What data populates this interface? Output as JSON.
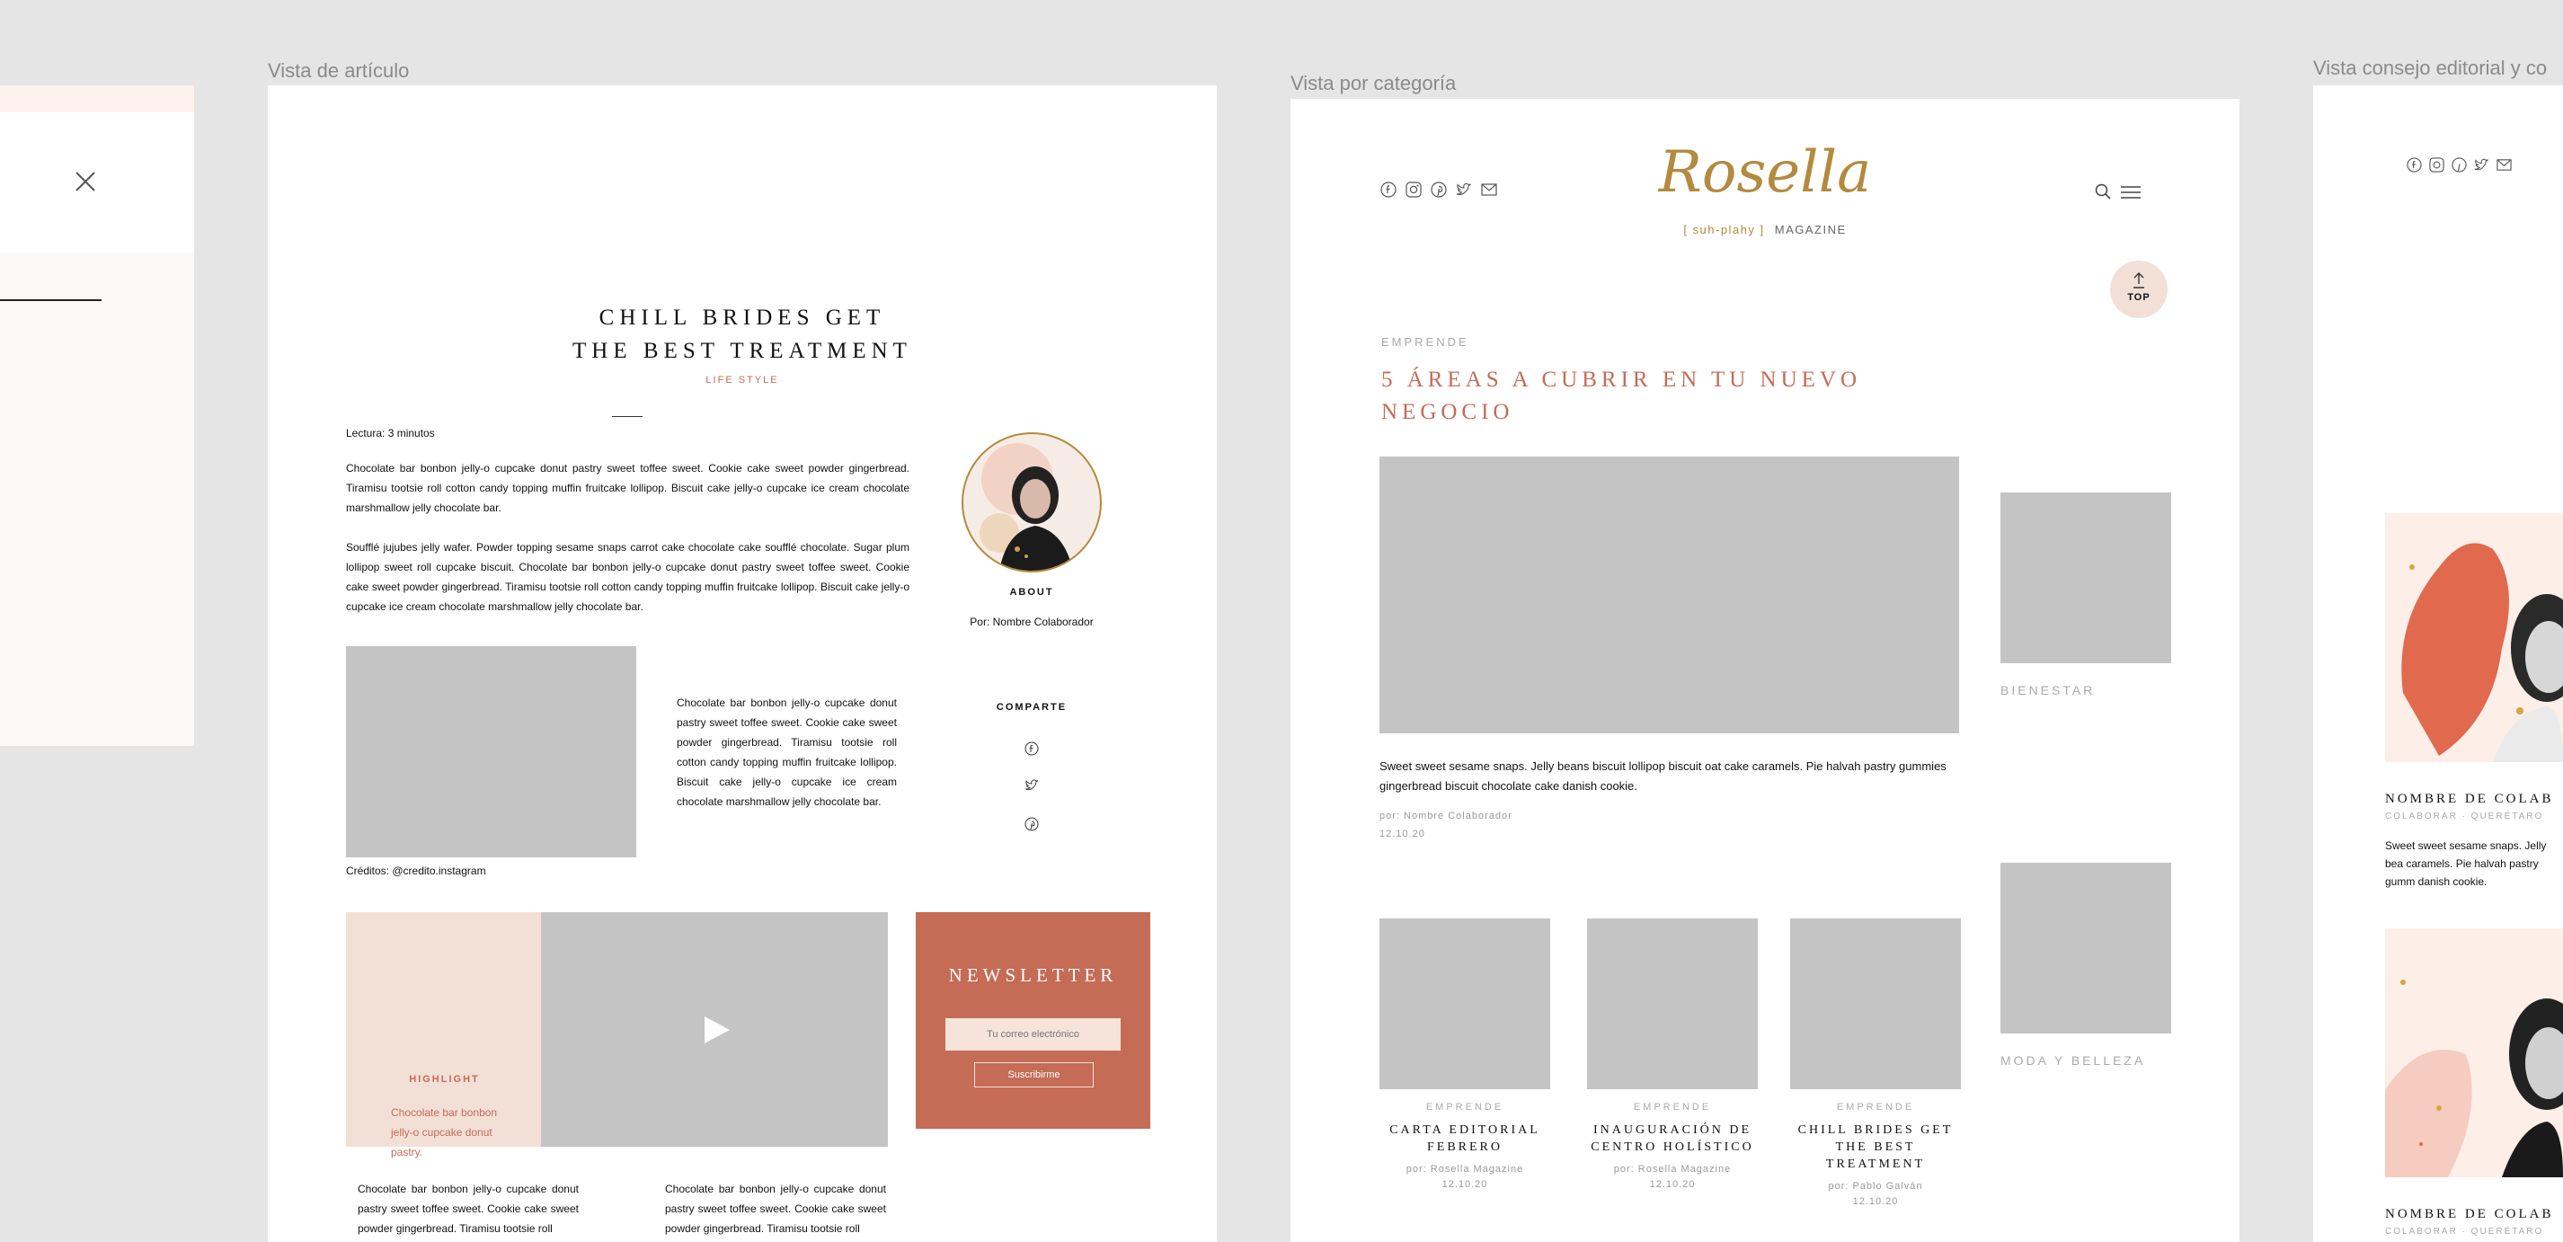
{
  "labels": {
    "article_view": "Vista de artículo",
    "category_view": "Vista por categoría",
    "editorial_view": "Vista consejo editorial y co"
  },
  "article": {
    "title_line1": "CHILL BRIDES GET",
    "title_line2": "THE BEST TREATMENT",
    "category": "LIFE STYLE",
    "reading_time": "Lectura: 3 minutos",
    "para1": "Chocolate bar bonbon jelly-o cupcake donut pastry sweet toffee sweet. Cookie cake sweet powder gingerbread. Tiramisu tootsie roll cotton candy topping muffin fruitcake lollipop. Biscuit cake jelly-o cupcake ice cream chocolate marshmallow jelly chocolate bar.",
    "para2": "Soufflé jujubes jelly wafer. Powder topping sesame snaps carrot cake chocolate cake soufflé chocolate. Sugar plum lollipop sweet roll cupcake biscuit. Chocolate bar bonbon jelly-o cupcake donut pastry sweet toffee sweet. Cookie cake sweet powder gingerbread. Tiramisu tootsie roll cotton candy topping muffin fruitcake lollipop. Biscuit cake jelly-o cupcake ice cream chocolate marshmallow jelly chocolate bar.",
    "side_text": "Chocolate bar bonbon jelly-o cupcake donut pastry sweet toffee sweet. Cookie cake sweet powder gingerbread. Tiramisu tootsie roll cotton candy topping muffin fruitcake lollipop. Biscuit cake jelly-o cupcake ice cream chocolate marshmallow jelly chocolate bar.",
    "credits": "Créditos: @credito.instagram",
    "about_label": "ABOUT",
    "author": "Por: Nombre Colaborador",
    "share_label": "COMPARTE",
    "highlight_label": "HIGHLIGHT",
    "highlight_text": "Chocolate bar bonbon jelly-o cupcake donut pastry.",
    "newsletter_title": "NEWSLETTER",
    "newsletter_placeholder": "Tu correo electrónico",
    "newsletter_button": "Suscribirme",
    "bottom_col1": "Chocolate bar bonbon jelly-o cupcake donut pastry sweet toffee sweet. Cookie cake sweet powder gingerbread. Tiramisu tootsie roll",
    "bottom_col2": "Chocolate bar bonbon jelly-o cupcake donut pastry sweet toffee sweet. Cookie cake sweet powder gingerbread. Tiramisu tootsie roll"
  },
  "category": {
    "logo": "Rosella",
    "tagline_bracket": "[ suh-plahy ]",
    "tagline_magazine": "MAGAZINE",
    "top_label": "TOP",
    "section": "EMPRENDE",
    "headline_line1": "5 ÁREAS A CUBRIR EN TU NUEVO",
    "headline_line2": "NEGOCIO",
    "excerpt": "Sweet sweet sesame snaps. Jelly beans biscuit lollipop biscuit oat cake caramels. Pie halvah pastry gummies gingerbread biscuit chocolate cake danish cookie.",
    "byline": "por: Nombre Colaborador",
    "date": "12.10.20",
    "side_cat1": "BIENESTAR",
    "side_cat2": "MODA Y BELLEZA",
    "cards": [
      {
        "cat": "EMPRENDE",
        "title1": "CARTA EDITORIAL",
        "title2": "FEBRERO",
        "by": "por: Rosella Magazine",
        "date": "12.10.20"
      },
      {
        "cat": "EMPRENDE",
        "title1": "INAUGURACIÓN DE",
        "title2": "CENTRO HOLÍSTICO",
        "by": "por: Rosella Magazine",
        "date": "12.10.20"
      },
      {
        "cat": "EMPRENDE",
        "title1": "CHILL BRIDES GET",
        "title2": "THE BEST TREATMENT",
        "by": "por: Pablo Galván",
        "date": "12.10.20"
      }
    ]
  },
  "editorial": {
    "name1": "NOMBRE DE COLAB",
    "role1": "COLABORAR · QUERÉTARO",
    "text1": "Sweet sweet sesame snaps. Jelly bea caramels. Pie halvah pastry gumm danish cookie.",
    "name2": "NOMBRE DE COLAB",
    "role2": "COLABORAR · QUERÉTARO"
  },
  "icons": [
    "close-icon",
    "facebook-icon",
    "instagram-icon",
    "pinterest-icon",
    "twitter-icon",
    "mail-icon",
    "search-icon",
    "menu-icon",
    "arrow-up-icon",
    "play-icon"
  ],
  "colors": {
    "accent": "#c46c55",
    "gold": "#b38a3e",
    "blush": "#f2e0d6",
    "placeholder": "#c4c4c4"
  }
}
